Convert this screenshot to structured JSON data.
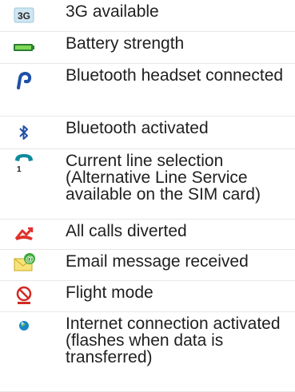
{
  "legend": [
    {
      "icon": "3g-icon",
      "text": "3G available"
    },
    {
      "icon": "battery-icon",
      "text": "Battery strength"
    },
    {
      "icon": "bluetooth-headset-icon",
      "text": "Bluetooth headset connected"
    },
    {
      "icon": "bluetooth-icon",
      "text": "Bluetooth activated"
    },
    {
      "icon": "line-selection-icon",
      "text": "Current line selection (Alternative Line Service available on the SIM card)"
    },
    {
      "icon": "calls-diverted-icon",
      "text": "All calls diverted"
    },
    {
      "icon": "email-received-icon",
      "text": "Email message received"
    },
    {
      "icon": "flight-mode-icon",
      "text": "Flight mode"
    },
    {
      "icon": "internet-connection-icon",
      "text": "Internet connection activated (flashes when data is transferred)"
    }
  ],
  "icon_badges": {
    "three_g": "3G",
    "line_number": "1"
  }
}
